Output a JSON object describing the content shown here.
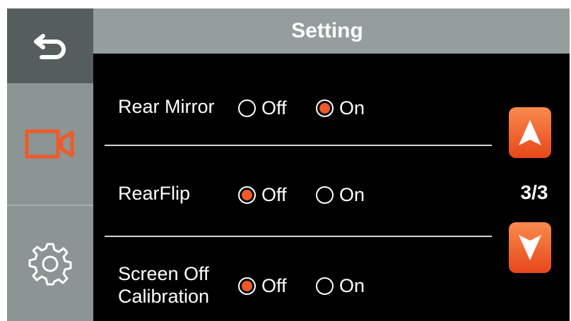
{
  "header": {
    "title": "Setting"
  },
  "sidebar": {
    "items": [
      {
        "icon": "back-arrow-icon",
        "active": true
      },
      {
        "icon": "video-camera-icon",
        "color": "#ef5a28"
      },
      {
        "icon": "gear-icon"
      }
    ]
  },
  "settings": [
    {
      "label": "Rear Mirror",
      "options": [
        "Off",
        "On"
      ],
      "selected": "On"
    },
    {
      "label": "RearFlip",
      "options": [
        "Off",
        "On"
      ],
      "selected": "Off"
    },
    {
      "label_line1": "Screen Off",
      "label_line2": "Calibration",
      "options": [
        "Off",
        "On"
      ],
      "selected": "Off"
    }
  ],
  "pager": {
    "indicator": "3/3"
  },
  "colors": {
    "accent": "#ef5a28",
    "header_bg": "#959d9d",
    "sidebar_active": "#565d5d",
    "sidebar_bg": "#8c9494"
  }
}
